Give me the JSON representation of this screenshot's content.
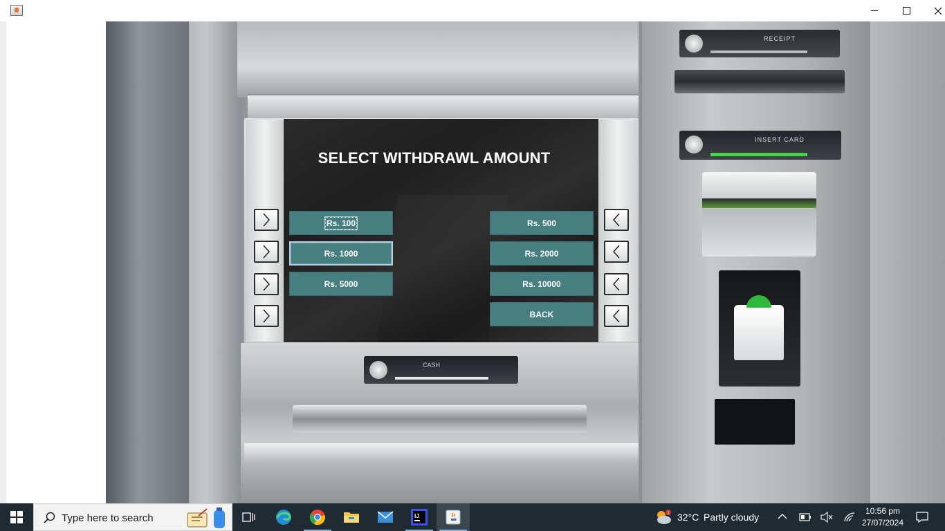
{
  "window": {
    "minimize_icon": "minimize-icon",
    "maximize_icon": "maximize-icon",
    "close_icon": "close-icon"
  },
  "atm": {
    "receipt_plate_text": "RECEIPT",
    "card_plate_text": "INSERT CARD",
    "cash_plate_text": "CASH"
  },
  "screen": {
    "title": "SELECT WITHDRAWL AMOUNT",
    "left_buttons": [
      "Rs. 100",
      "Rs. 1000",
      "Rs. 5000"
    ],
    "right_buttons": [
      "Rs. 500",
      "Rs. 2000",
      "Rs. 10000",
      "BACK"
    ],
    "button_color": "#477f80"
  },
  "taskbar": {
    "search_placeholder": "Type here to search",
    "weather_temp": "32°C",
    "weather_desc": "Partly cloudy",
    "time": "10:56 pm",
    "date": "27/07/2024",
    "apps": [
      "task-view-icon",
      "edge-icon",
      "chrome-icon",
      "file-explorer-icon",
      "mail-icon",
      "intellij-icon",
      "java-icon"
    ]
  }
}
